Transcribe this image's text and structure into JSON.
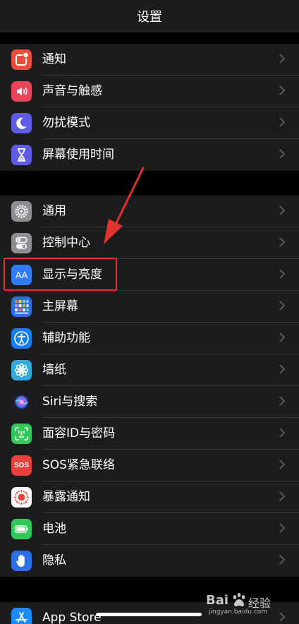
{
  "navbar": {
    "title": "设置"
  },
  "groups": [
    {
      "items": [
        {
          "label": "通知",
          "icon": "notifications-icon",
          "color": "#eb4d3d"
        },
        {
          "label": "声音与触感",
          "icon": "sounds-icon",
          "color": "#eb445a"
        },
        {
          "label": "勿扰模式",
          "icon": "moon-icon",
          "color": "#5e5ce6"
        },
        {
          "label": "屏幕使用时间",
          "icon": "hourglass-icon",
          "color": "#5e5ce6"
        }
      ]
    },
    {
      "items": [
        {
          "label": "通用",
          "icon": "gear-icon",
          "color": "#8e8e93"
        },
        {
          "label": "控制中心",
          "icon": "toggles-icon",
          "color": "#8e8e93"
        },
        {
          "label": "显示与亮度",
          "icon": "display-aa-icon",
          "color": "#2f7cf6"
        },
        {
          "label": "主屏幕",
          "icon": "home-screen-icon",
          "color": "#2f6fe6"
        },
        {
          "label": "辅助功能",
          "icon": "accessibility-icon",
          "color": "#1a7cf2"
        },
        {
          "label": "墙纸",
          "icon": "wallpaper-flower-icon",
          "color": "#34aadc"
        },
        {
          "label": "Siri与搜索",
          "icon": "siri-icon",
          "color": "#2a2a3a"
        },
        {
          "label": "面容ID与密码",
          "icon": "face-id-icon",
          "color": "#34c759"
        },
        {
          "label": "SOS紧急联络",
          "icon": "sos-icon",
          "color": "#e6413a"
        },
        {
          "label": "暴露通知",
          "icon": "exposure-icon",
          "color": "#ffffff"
        },
        {
          "label": "电池",
          "icon": "battery-icon",
          "color": "#34c759"
        },
        {
          "label": "隐私",
          "icon": "hand-icon",
          "color": "#2f6fe6"
        }
      ]
    },
    {
      "items": [
        {
          "label": "App Store",
          "icon": "app-store-icon",
          "color": "#1a8cff"
        }
      ]
    }
  ],
  "icon_texts": {
    "display": "AA",
    "sos": "SOS"
  },
  "watermark": {
    "brand": "Bai",
    "brand_suffix": "经验",
    "url": "jingyan.baidu.com"
  },
  "colors": {
    "highlight": "#e0322f",
    "background": "#000000",
    "cell": "#1c1c1e"
  }
}
